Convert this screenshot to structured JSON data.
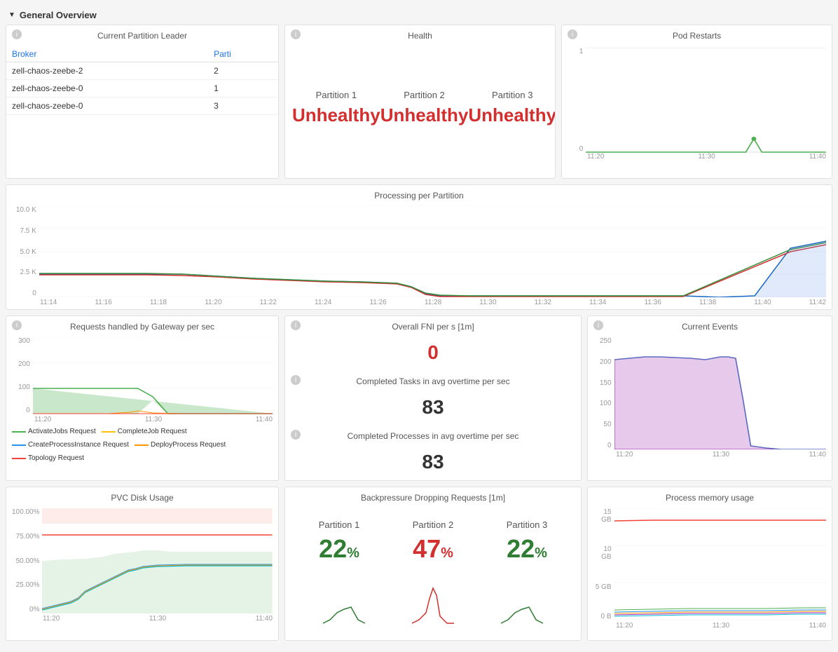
{
  "section": {
    "title": "General Overview",
    "arrow": "▼"
  },
  "partition_leader": {
    "title": "Current Partition Leader",
    "col_broker": "Broker",
    "col_partition": "Parti",
    "rows": [
      {
        "broker": "zell-chaos-zeebe-2",
        "partition": "2"
      },
      {
        "broker": "zell-chaos-zeebe-0",
        "partition": "1"
      },
      {
        "broker": "zell-chaos-zeebe-0",
        "partition": "3"
      }
    ]
  },
  "health": {
    "title": "Health",
    "partitions": [
      {
        "label": "Partition 1",
        "status": "Unhealthy"
      },
      {
        "label": "Partition 2",
        "status": "Unhealthy"
      },
      {
        "label": "Partition 3",
        "status": "Unhealthy"
      }
    ]
  },
  "pod_restarts": {
    "title": "Pod Restarts",
    "y_labels": [
      "1",
      "0"
    ],
    "x_labels": [
      "11:20",
      "11:30",
      "11:40"
    ]
  },
  "processing": {
    "title": "Processing per Partition",
    "y_labels": [
      "10.0 K",
      "7.5 K",
      "5.0 K",
      "2.5 K",
      "0"
    ],
    "x_labels": [
      "11:14",
      "11:16",
      "11:18",
      "11:20",
      "11:22",
      "11:24",
      "11:26",
      "11:28",
      "11:30",
      "11:32",
      "11:34",
      "11:36",
      "11:38",
      "11:40",
      "11:42"
    ]
  },
  "gateway": {
    "title": "Requests handled by Gateway per sec",
    "y_labels": [
      "300",
      "200",
      "100",
      "0"
    ],
    "x_labels": [
      "11:20",
      "11:30",
      "11:40"
    ],
    "legend": [
      {
        "label": "ActivateJobs Request",
        "color": "#4caf50"
      },
      {
        "label": "CompleteJob Request",
        "color": "#ffc107"
      },
      {
        "label": "CreateProcessInstance Request",
        "color": "#2196f3"
      },
      {
        "label": "DeployProcess Request",
        "color": "#ff9800"
      },
      {
        "label": "Topology Request",
        "color": "#f44336"
      }
    ]
  },
  "fnl": {
    "title": "Overall FNI per s [1m]",
    "value": "0",
    "completed_tasks_title": "Completed Tasks in avg overtime per sec",
    "completed_tasks_value": "83",
    "completed_processes_title": "Completed Processes in avg overtime per sec",
    "completed_processes_value": "83"
  },
  "events": {
    "title": "Current Events",
    "y_labels": [
      "250",
      "200",
      "150",
      "100",
      "50",
      "0"
    ],
    "x_labels": [
      "11:20",
      "11:30",
      "11:40"
    ]
  },
  "pvc": {
    "title": "PVC Disk Usage",
    "y_labels": [
      "100.00%",
      "75.00%",
      "50.00%",
      "25.00%",
      "0%"
    ],
    "x_labels": [
      "11:20",
      "11:30",
      "11:40"
    ]
  },
  "backpressure": {
    "title": "Backpressure Dropping Requests [1m]",
    "partitions": [
      {
        "label": "Partition 1",
        "value": "22",
        "color": "green"
      },
      {
        "label": "Partition 2",
        "value": "47",
        "color": "red"
      },
      {
        "label": "Partition 3",
        "value": "22",
        "color": "green"
      }
    ]
  },
  "memory": {
    "title": "Process memory usage",
    "y_labels": [
      "15 GB",
      "10 GB",
      "5 GB",
      "0 B"
    ],
    "x_labels": [
      "11:20",
      "11:30",
      "11:40"
    ]
  }
}
